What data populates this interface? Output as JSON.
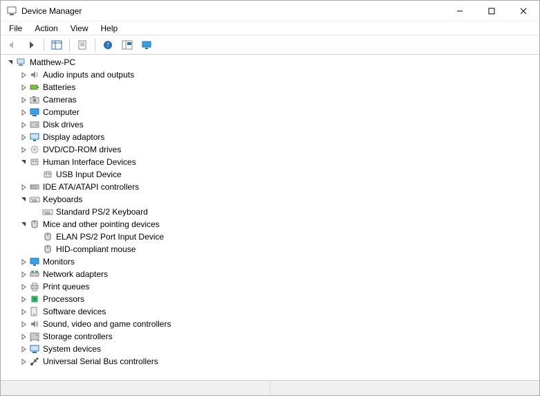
{
  "window": {
    "title": "Device Manager"
  },
  "menu": {
    "file": "File",
    "action": "Action",
    "view": "View",
    "help": "Help"
  },
  "toolbar": {
    "back": "back",
    "forward": "forward",
    "show_hide": "show-hide-console-tree",
    "properties": "properties",
    "help": "help",
    "scan": "scan-for-hardware-changes",
    "monitor": "display"
  },
  "tree": {
    "root": {
      "label": "Matthew-PC",
      "icon": "pc",
      "expanded": true
    },
    "items": [
      {
        "label": "Audio inputs and outputs",
        "icon": "audio",
        "expanded": false,
        "children": []
      },
      {
        "label": "Batteries",
        "icon": "battery",
        "expanded": false,
        "children": []
      },
      {
        "label": "Cameras",
        "icon": "camera",
        "expanded": false,
        "children": []
      },
      {
        "label": "Computer",
        "icon": "computer",
        "expanded": false,
        "children": []
      },
      {
        "label": "Disk drives",
        "icon": "disk",
        "expanded": false,
        "children": []
      },
      {
        "label": "Display adaptors",
        "icon": "display",
        "expanded": false,
        "children": []
      },
      {
        "label": "DVD/CD-ROM drives",
        "icon": "optical",
        "expanded": false,
        "children": []
      },
      {
        "label": "Human Interface Devices",
        "icon": "hid",
        "expanded": true,
        "children": [
          {
            "label": "USB Input Device",
            "icon": "hid"
          }
        ]
      },
      {
        "label": "IDE ATA/ATAPI controllers",
        "icon": "ide",
        "expanded": false,
        "children": []
      },
      {
        "label": "Keyboards",
        "icon": "keyboard",
        "expanded": true,
        "children": [
          {
            "label": "Standard PS/2 Keyboard",
            "icon": "keyboard"
          }
        ]
      },
      {
        "label": "Mice and other pointing devices",
        "icon": "mouse",
        "expanded": true,
        "children": [
          {
            "label": "ELAN PS/2 Port Input Device",
            "icon": "mouse"
          },
          {
            "label": "HID-compliant mouse",
            "icon": "mouse"
          }
        ]
      },
      {
        "label": "Monitors",
        "icon": "monitor",
        "expanded": false,
        "children": []
      },
      {
        "label": "Network adapters",
        "icon": "network",
        "expanded": false,
        "children": []
      },
      {
        "label": "Print queues",
        "icon": "printer",
        "expanded": false,
        "children": []
      },
      {
        "label": "Processors",
        "icon": "cpu",
        "expanded": false,
        "children": []
      },
      {
        "label": "Software devices",
        "icon": "software",
        "expanded": false,
        "children": []
      },
      {
        "label": "Sound, video and game controllers",
        "icon": "sound",
        "expanded": false,
        "children": []
      },
      {
        "label": "Storage controllers",
        "icon": "storage",
        "expanded": false,
        "children": []
      },
      {
        "label": "System devices",
        "icon": "system",
        "expanded": false,
        "children": []
      },
      {
        "label": "Universal Serial Bus controllers",
        "icon": "usb",
        "expanded": false,
        "children": []
      }
    ]
  }
}
